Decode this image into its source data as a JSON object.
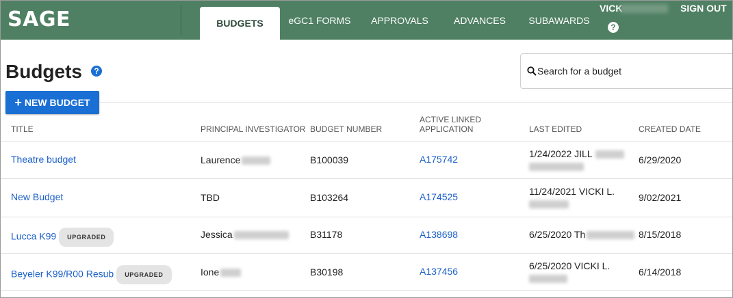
{
  "app": {
    "logo": "SAGE",
    "nav_tabs": [
      {
        "label": "BUDGETS",
        "active": true
      },
      {
        "label": "eGC1 FORMS",
        "active": false
      },
      {
        "label": "APPROVALS",
        "active": false
      },
      {
        "label": "ADVANCES",
        "active": false
      },
      {
        "label": "SUBAWARDS",
        "active": false
      }
    ],
    "user_name": "VICK",
    "sign_out": "SIGN OUT",
    "help_glyph": "?",
    "brand_color": "#4f8063",
    "accent_color": "#1a6fd4"
  },
  "page": {
    "title": "Budgets",
    "help_glyph": "?",
    "search_placeholder": "Search for a budget",
    "new_button_label": "NEW BUDGET",
    "new_button_icon": "plus-icon"
  },
  "table": {
    "columns": [
      "TITLE",
      "PRINCIPAL INVESTIGATOR",
      "BUDGET NUMBER",
      "ACTIVE LINKED APPLICATION",
      "LAST EDITED",
      "CREATED DATE"
    ],
    "rows": [
      {
        "title": "Theatre budget",
        "badge": "",
        "pi": "Laurence",
        "number": "B100039",
        "app": "A175742",
        "edited_line1": "1/24/2022 JILL",
        "created": "6/29/2020"
      },
      {
        "title": "New Budget",
        "badge": "",
        "pi": "TBD",
        "number": "B103264",
        "app": "A174525",
        "edited_line1": "11/24/2021 VICKI L.",
        "created": "9/02/2021"
      },
      {
        "title": "Lucca K99",
        "badge": "UPGRADED",
        "pi": "Jessica",
        "number": "B31178",
        "app": "A138698",
        "edited_line1": "6/25/2020 Th",
        "created": "8/15/2018"
      },
      {
        "title": "Beyeler K99/R00 Resub",
        "badge": "UPGRADED",
        "pi": "Ione",
        "number": "B30198",
        "app": "A137456",
        "edited_line1": "6/25/2020 VICKI L.",
        "created": "6/14/2018"
      }
    ]
  }
}
